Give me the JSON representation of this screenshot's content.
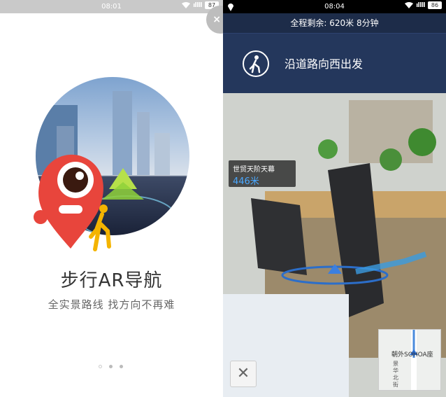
{
  "left": {
    "status": {
      "time": "08:01",
      "signal": "ıllll",
      "battery": "87"
    },
    "close_label": "×",
    "title": "步行AR导航",
    "subtitle": "全实景路线 找方向不再难",
    "dots": 3
  },
  "right": {
    "status": {
      "time": "08:04",
      "signal": "ıllll",
      "battery": "86"
    },
    "summary": "全程剩余: 620米  8分钟",
    "instruction": "沿道路向西出发",
    "poi": {
      "name": "世贸天阶天幕",
      "distance": "446米"
    },
    "minimap": {
      "label": "朝外SOHOA座",
      "street": "景华北街"
    },
    "close_label": "✕"
  },
  "colors": {
    "nav_dark": "#1d2c49",
    "nav_panel": "#24375c",
    "poi_distance": "#4aa8ff",
    "mascot_red": "#e8453c",
    "arrow_blue": "#3b7fe0"
  }
}
